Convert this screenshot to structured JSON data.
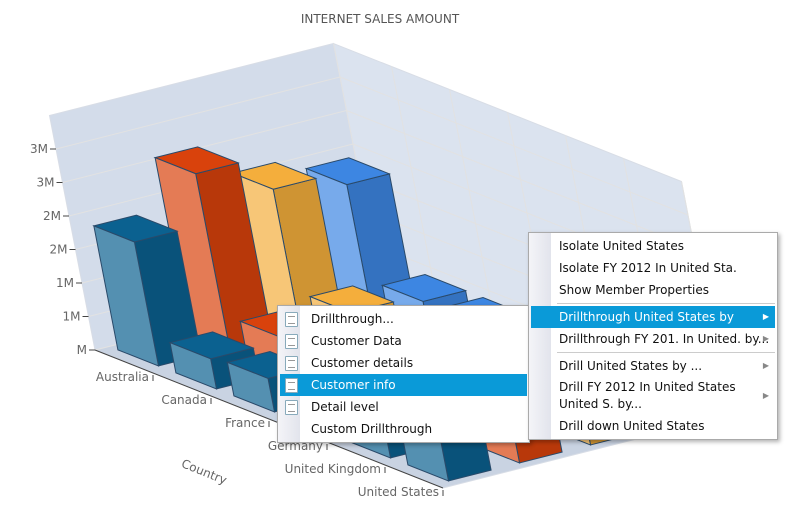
{
  "chart_data": {
    "type": "bar3d",
    "title": "INTERNET SALES AMOUNT",
    "xlabel": "Country",
    "categories": [
      "Australia",
      "Canada",
      "France",
      "Germany",
      "United Kingdom",
      "United States"
    ],
    "ytick_labels": [
      "M",
      "1M",
      "1M",
      "2M",
      "2M",
      "3M",
      "3M"
    ],
    "ylim": [
      0,
      3.5
    ],
    "series": [
      {
        "color": "#0b6190",
        "values": [
          1.85,
          0.45,
          0.5,
          0.5,
          0.6,
          2.0
        ]
      },
      {
        "color": "#d9420c",
        "values": [
          2.6,
          0.5,
          0.55,
          0.5,
          0.6,
          1.8
        ]
      },
      {
        "color": "#f4ae3c",
        "values": [
          2.1,
          0.6,
          0.6,
          0.5,
          0.5,
          0.5
        ]
      },
      {
        "color": "#3d86e2",
        "values": [
          1.9,
          0.5,
          0.5,
          0.5,
          0.5,
          0.5
        ]
      }
    ]
  },
  "menu_main": {
    "items": [
      {
        "label": "Isolate United States"
      },
      {
        "label": "Isolate FY 2012 In United Sta."
      },
      {
        "label": "Show Member Properties"
      },
      {
        "label": "Drillthrough United States by",
        "submenu": true,
        "selected": true
      },
      {
        "label": "Drillthrough FY 201. In United. by...",
        "submenu": true
      },
      {
        "label": "Drill United States by ...",
        "submenu": true
      },
      {
        "label": "Drill FY 2012 In United States United S. by...",
        "submenu": true
      },
      {
        "label": "Drill down United States"
      }
    ]
  },
  "menu_sub": {
    "items": [
      {
        "label": "Drillthrough...",
        "icon": "document-icon"
      },
      {
        "label": "Customer Data",
        "icon": "document-icon"
      },
      {
        "label": "Customer details",
        "icon": "document-icon"
      },
      {
        "label": "Customer info",
        "icon": "document-icon",
        "selected": true
      },
      {
        "label": "Detail level",
        "icon": "document-icon"
      },
      {
        "label": "Custom Drillthrough"
      }
    ]
  }
}
